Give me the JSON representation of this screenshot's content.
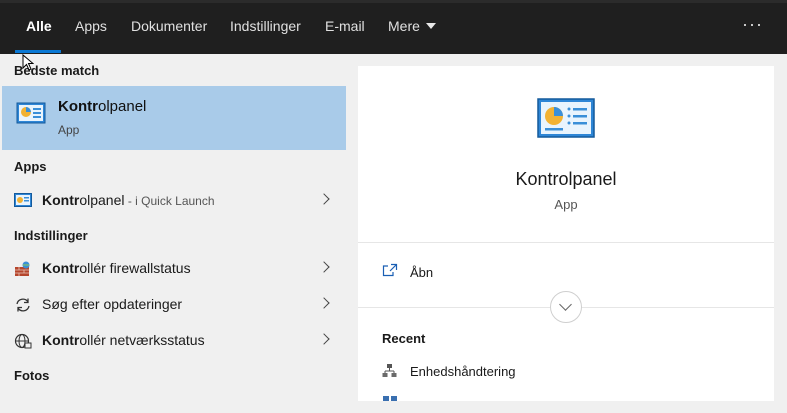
{
  "tabs": [
    {
      "label": "Alle",
      "active": true
    },
    {
      "label": "Apps"
    },
    {
      "label": "Dokumenter"
    },
    {
      "label": "Indstillinger"
    },
    {
      "label": "E-mail"
    },
    {
      "label": "Mere"
    }
  ],
  "more_icon": "more-dots-icon",
  "best_match": {
    "header": "Bedste match",
    "title_bold": "Kontr",
    "title_rest": "olpanel",
    "subtitle": "App",
    "icon": "control-panel-icon"
  },
  "apps_section": {
    "header": "Apps",
    "items": [
      {
        "bold": "Kontr",
        "rest": "olpanel",
        "sub": " - i Quick Launch",
        "icon": "control-panel-icon"
      }
    ]
  },
  "settings_section": {
    "header": "Indstillinger",
    "items": [
      {
        "bold": "Kontr",
        "rest": "ollér firewallstatus",
        "icon": "firewall-icon"
      },
      {
        "bold": "",
        "rest": "Søg efter opdateringer",
        "icon": "refresh-icon"
      },
      {
        "bold": "Kontr",
        "rest": "ollér netværksstatus",
        "icon": "network-icon"
      }
    ]
  },
  "photos_section": {
    "header": "Fotos"
  },
  "detail": {
    "title": "Kontrolpanel",
    "type": "App",
    "open_label": "Åbn",
    "recent_header": "Recent",
    "recent_items": [
      {
        "label": "Enhedshåndtering",
        "icon": "device-manager-icon"
      }
    ]
  },
  "colors": {
    "topbar": "#1f1f1f",
    "accent": "#0a78d4",
    "selection": "#a9cbe9",
    "panel": "#f0f0f0",
    "detail_bg": "#ffffff"
  }
}
